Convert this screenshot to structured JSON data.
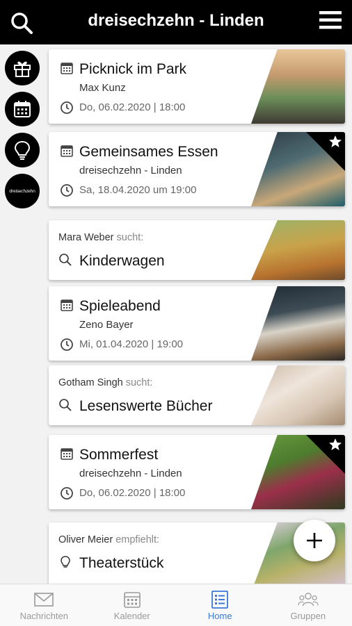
{
  "header": {
    "title": "dreisechzehn - Linden",
    "search_icon": "search-icon",
    "menu_icon": "hamburger-menu-icon"
  },
  "sidebar": {
    "items": [
      {
        "icon": "gift-icon"
      },
      {
        "icon": "calendar-icon"
      },
      {
        "icon": "lightbulb-icon"
      },
      {
        "icon": "logo",
        "label": "dreisechzehn"
      }
    ]
  },
  "cards": [
    {
      "type": "event",
      "title": "Picknick im Park",
      "subtitle": "Max Kunz",
      "date": "Do, 06.02.2020 | 18:00",
      "starred": false
    },
    {
      "type": "event",
      "title": "Gemeinsames Essen",
      "subtitle": "dreisechzehn - Linden",
      "date": "Sa, 18.04.2020 um 19:00",
      "starred": true
    },
    {
      "type": "search",
      "user": "Mara Weber",
      "verb": "sucht:",
      "title": "Kinderwagen"
    },
    {
      "type": "event",
      "title": "Spieleabend",
      "subtitle": "Zeno Bayer",
      "date": "Mi, 01.04.2020 | 19:00",
      "starred": false
    },
    {
      "type": "search",
      "user": "Gotham Singh",
      "verb": "sucht:",
      "title": "Lesenswerte Bücher"
    },
    {
      "type": "event",
      "title": "Sommerfest",
      "subtitle": "dreisechzehn - Linden",
      "date": "Do, 06.02.2020 | 18:00",
      "starred": true
    },
    {
      "type": "recommend",
      "user": "Oliver Meier",
      "verb": "empfiehlt:",
      "title": "Theaterstück"
    }
  ],
  "fab": {
    "icon": "plus-icon"
  },
  "bottom_nav": {
    "tabs": [
      {
        "label": "Nachrichten",
        "icon": "envelope-icon",
        "active": false
      },
      {
        "label": "Kalender",
        "icon": "calendar-icon",
        "active": false
      },
      {
        "label": "Home",
        "icon": "list-icon",
        "active": true
      },
      {
        "label": "Gruppen",
        "icon": "group-icon",
        "active": false
      }
    ]
  },
  "colors": {
    "topbar": "#000000",
    "accent": "#3b78d8",
    "inactive": "#999999"
  }
}
